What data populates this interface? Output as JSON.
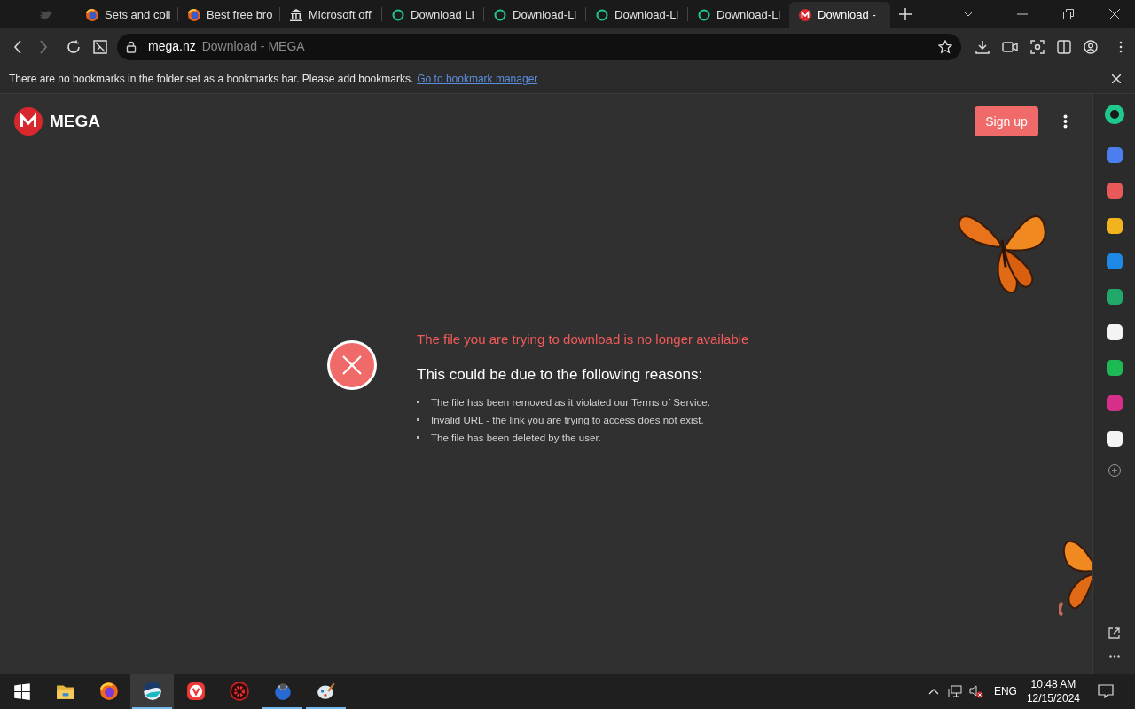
{
  "tabs": [
    {
      "kind": "bird",
      "selected": false
    },
    {
      "kind": "firefox",
      "label": "Sets and coll",
      "selected": false
    },
    {
      "kind": "firefox",
      "label": "Best free bro",
      "selected": false
    },
    {
      "kind": "building",
      "label": "Microsoft off",
      "selected": false
    },
    {
      "kind": "ring",
      "label": "Download Li",
      "selected": false
    },
    {
      "kind": "ring",
      "label": "Download-Li",
      "selected": false
    },
    {
      "kind": "ring",
      "label": "Download-Li",
      "selected": false
    },
    {
      "kind": "ring",
      "label": "Download-Li",
      "selected": false
    },
    {
      "kind": "mega",
      "label": "Download - ",
      "selected": true
    }
  ],
  "address": {
    "domain": "mega.nz",
    "title": "Download - MEGA"
  },
  "bookmarks_bar": {
    "message": "There are no bookmarks in the folder set as a bookmarks bar. Please add bookmarks.",
    "link": "Go to bookmark manager"
  },
  "page": {
    "logo": "MEGA",
    "sign_up": "Sign up",
    "error_title": "The file you are trying to download is no longer available",
    "reasons_heading": "This could be due to the following reasons:",
    "reasons": [
      "The file has been removed as it violated our Terms of Service.",
      "Invalid URL - the link you are trying to access does not exist.",
      "The file has been deleted by the user."
    ]
  },
  "sidebar": [
    {
      "kind": "dot",
      "color": "#1ec98b"
    },
    {
      "kind": "app",
      "color": "#4d7ef0"
    },
    {
      "kind": "app",
      "color": "#e85a5a"
    },
    {
      "kind": "app",
      "color": "#f2b41c"
    },
    {
      "kind": "app",
      "color": "#1e88e5"
    },
    {
      "kind": "app",
      "color": "#22a86a"
    },
    {
      "kind": "app",
      "color": "#f4f4f4"
    },
    {
      "kind": "app",
      "color": "#1db954"
    },
    {
      "kind": "app",
      "color": "#d62f8a"
    },
    {
      "kind": "app",
      "color": "#f4f4f4"
    },
    {
      "kind": "add",
      "color": "#9a9a9a"
    }
  ],
  "taskbar": [
    {
      "kind": "start",
      "selected": false,
      "running": false
    },
    {
      "kind": "folder",
      "selected": false,
      "running": false
    },
    {
      "kind": "firefox",
      "selected": false,
      "running": false
    },
    {
      "kind": "browser",
      "selected": true,
      "running": true
    },
    {
      "kind": "vivaldi",
      "selected": false,
      "running": false
    },
    {
      "kind": "gear",
      "selected": false,
      "running": false
    },
    {
      "kind": "globe",
      "selected": false,
      "running": true
    },
    {
      "kind": "palette",
      "selected": false,
      "running": true
    }
  ],
  "tray": {
    "language": "ENG",
    "time": "10:48 AM",
    "date": "12/15/2024"
  }
}
